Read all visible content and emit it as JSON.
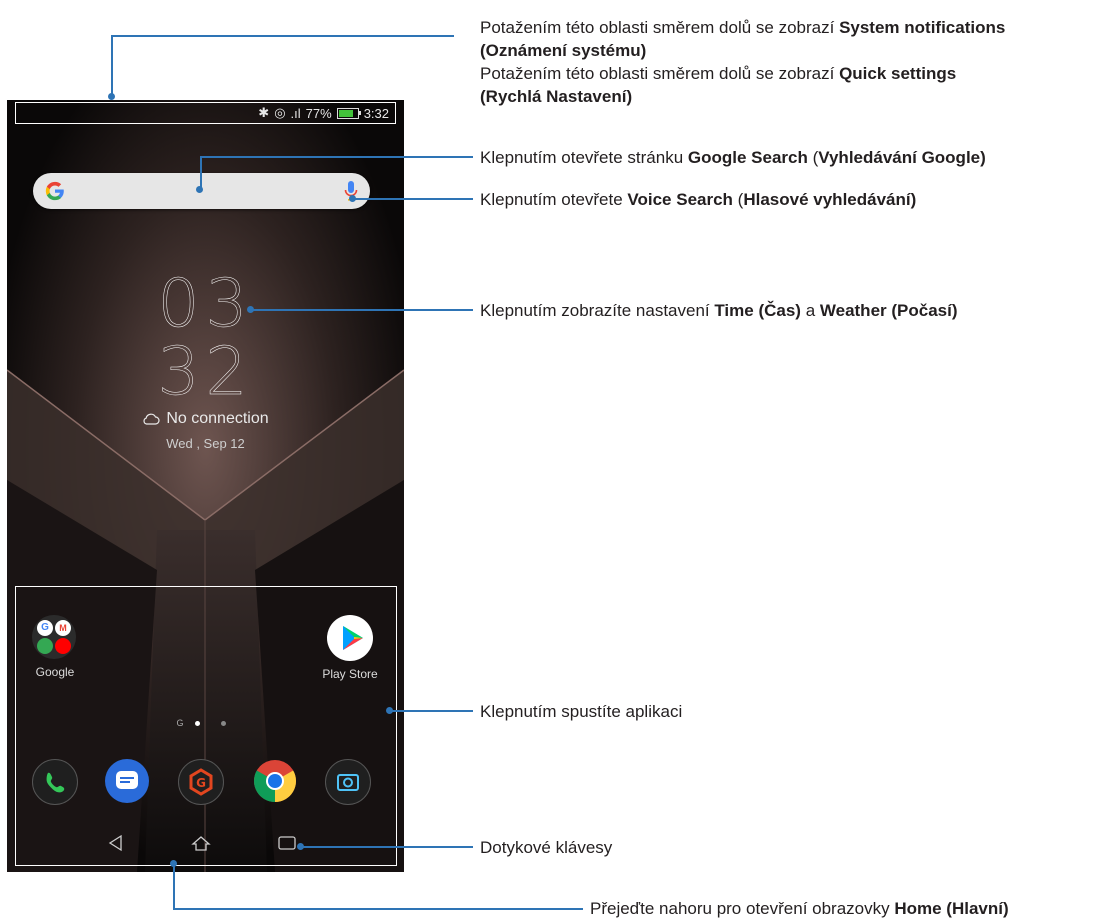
{
  "status_bar": {
    "battery": "77%",
    "time": "3:32"
  },
  "clock": {
    "hour": "03",
    "minute": "32"
  },
  "weather": {
    "text": "No connection",
    "date": "Wed , Sep 12"
  },
  "apps": {
    "folder_label": "Google",
    "store_label": "Play Store",
    "page_indicator_g": "G"
  },
  "callouts": {
    "c1a": "Potažením této oblasti směrem dolů se zobrazí ",
    "c1b": "System notifications",
    "c1c": "(Oznámení systému)",
    "c2a": "Potažením této oblasti směrem dolů se zobrazí ",
    "c2b": "Quick settings",
    "c2c": "(Rychlá Nastavení)",
    "c3a": "Klepnutím otevřete stránku ",
    "c3b": "Google Search",
    "c3c": " (",
    "c3d": "Vyhledávání Google)",
    "c4a": "Klepnutím otevřete ",
    "c4b": "Voice Search",
    "c4c": " (",
    "c4d": "Hlasové vyhledávání)",
    "c5a": "Klepnutím zobrazíte nastavení ",
    "c5b": "Time (Čas)",
    "c5c": " a ",
    "c5d": "Weather (Počasí)",
    "c6": "Klepnutím spustíte aplikaci",
    "c7": "Dotykové klávesy",
    "c8a": "Přejeďte nahoru pro otevření obrazovky ",
    "c8b": "Home (Hlavní)"
  },
  "colors": {
    "callout_line": "#2e74b5",
    "chrome": "#1a73e8",
    "messages": "#2a6bd9",
    "game": "#e2461f"
  }
}
